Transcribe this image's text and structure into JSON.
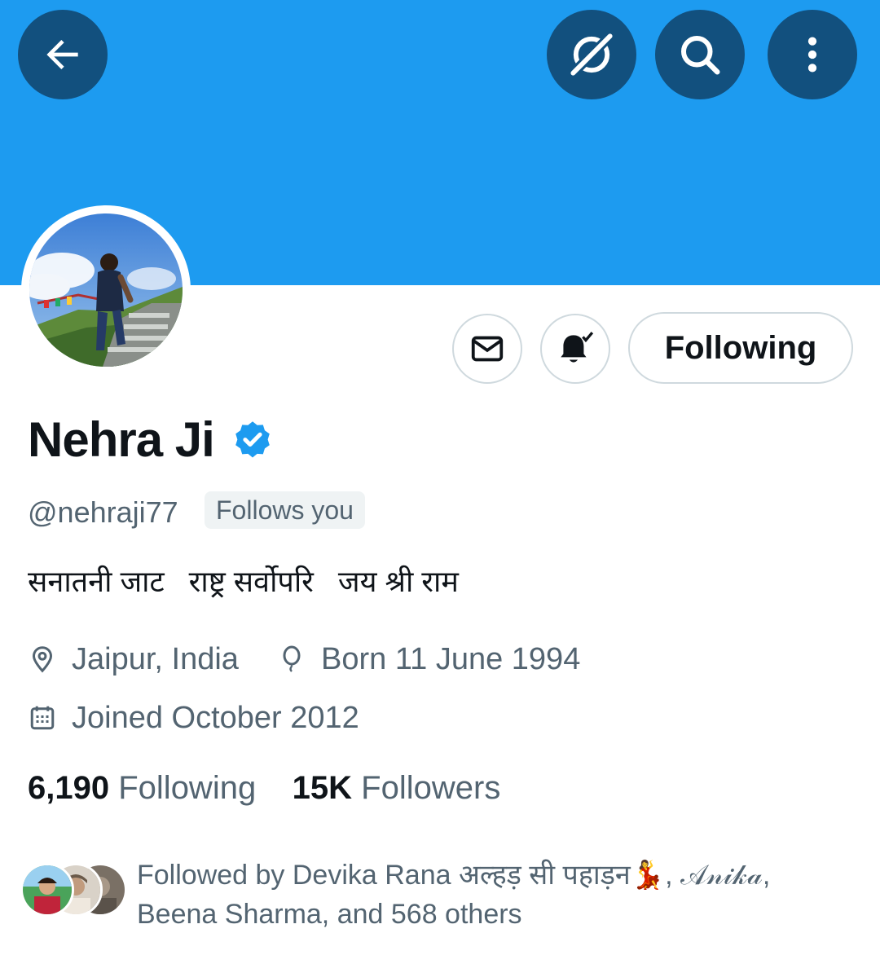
{
  "header": {
    "back_icon": "arrow-left-icon",
    "grok_icon": "grok-icon",
    "search_icon": "search-icon",
    "more_icon": "more-vertical-icon"
  },
  "colors": {
    "banner": "#1d9bf0",
    "header_button": "#12507e",
    "verified": "#1d9bf0",
    "secondary_text": "#536471",
    "primary_text": "#0f1419"
  },
  "actions": {
    "message_icon": "envelope-icon",
    "notify_icon": "bell-check-icon",
    "following_label": "Following"
  },
  "profile": {
    "name": "Nehra Ji",
    "verified_icon": "verified-badge-icon",
    "handle": "@nehraji77",
    "follows_you": "Follows you",
    "bio": "सनातनी जाट   राष्ट्र सर्वोपरि   जय श्री राम",
    "location": "Jaipur, India",
    "birthday": "Born 11 June 1994",
    "joined": "Joined October 2012"
  },
  "stats": {
    "following_count": "6,190",
    "following_label": "Following",
    "followers_count": "15K",
    "followers_label": "Followers"
  },
  "followed_by": {
    "line1": "Followed by Devika Rana अल्हड़ सी पहाड़न💃, 𝒜𝓃𝒾𝓀𝒶,",
    "line2": "Beena Sharma, and 568 others"
  }
}
